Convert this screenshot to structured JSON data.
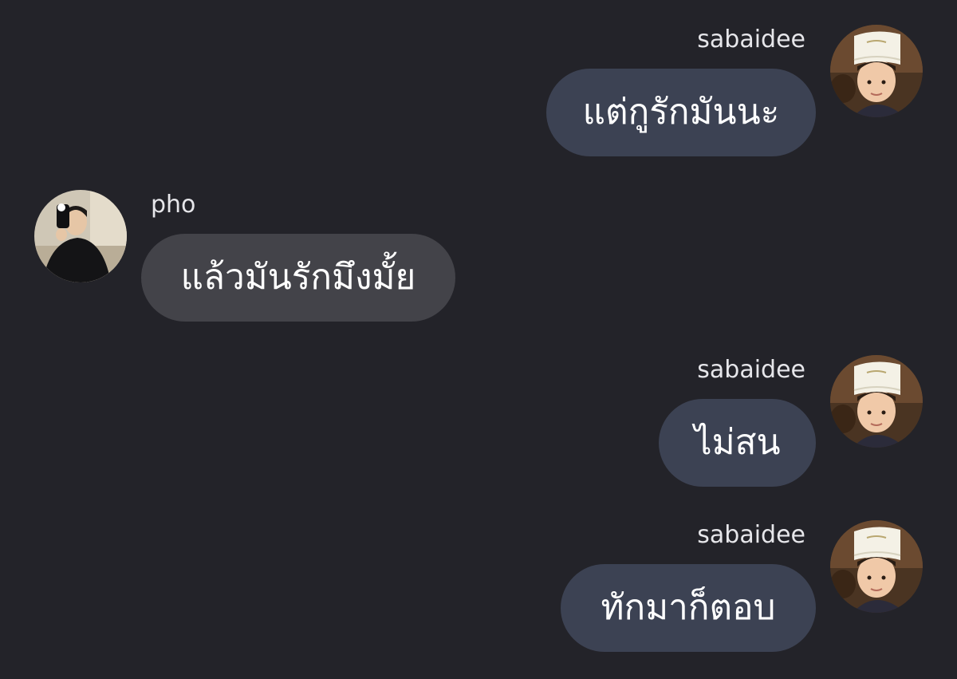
{
  "messages": [
    {
      "sender": "sabaidee",
      "text": "แต่กูรักมันนะ",
      "direction": "outgoing",
      "avatar_icon": "child-paper-hat-avatar-icon"
    },
    {
      "sender": "pho",
      "text": "แล้วมันรักมึงมั้ย",
      "direction": "incoming",
      "avatar_icon": "mirror-selfie-avatar-icon"
    },
    {
      "sender": "sabaidee",
      "text": "ไม่สน",
      "direction": "outgoing",
      "avatar_icon": "child-paper-hat-avatar-icon"
    },
    {
      "sender": "sabaidee",
      "text": "ทักมาก็ตอบ",
      "direction": "outgoing",
      "avatar_icon": "child-paper-hat-avatar-icon"
    }
  ],
  "colors": {
    "background": "#232329",
    "outgoing_bubble": "#3c4253",
    "incoming_bubble": "#434349",
    "name_text": "#e6e6ea",
    "message_text": "#ffffff"
  }
}
